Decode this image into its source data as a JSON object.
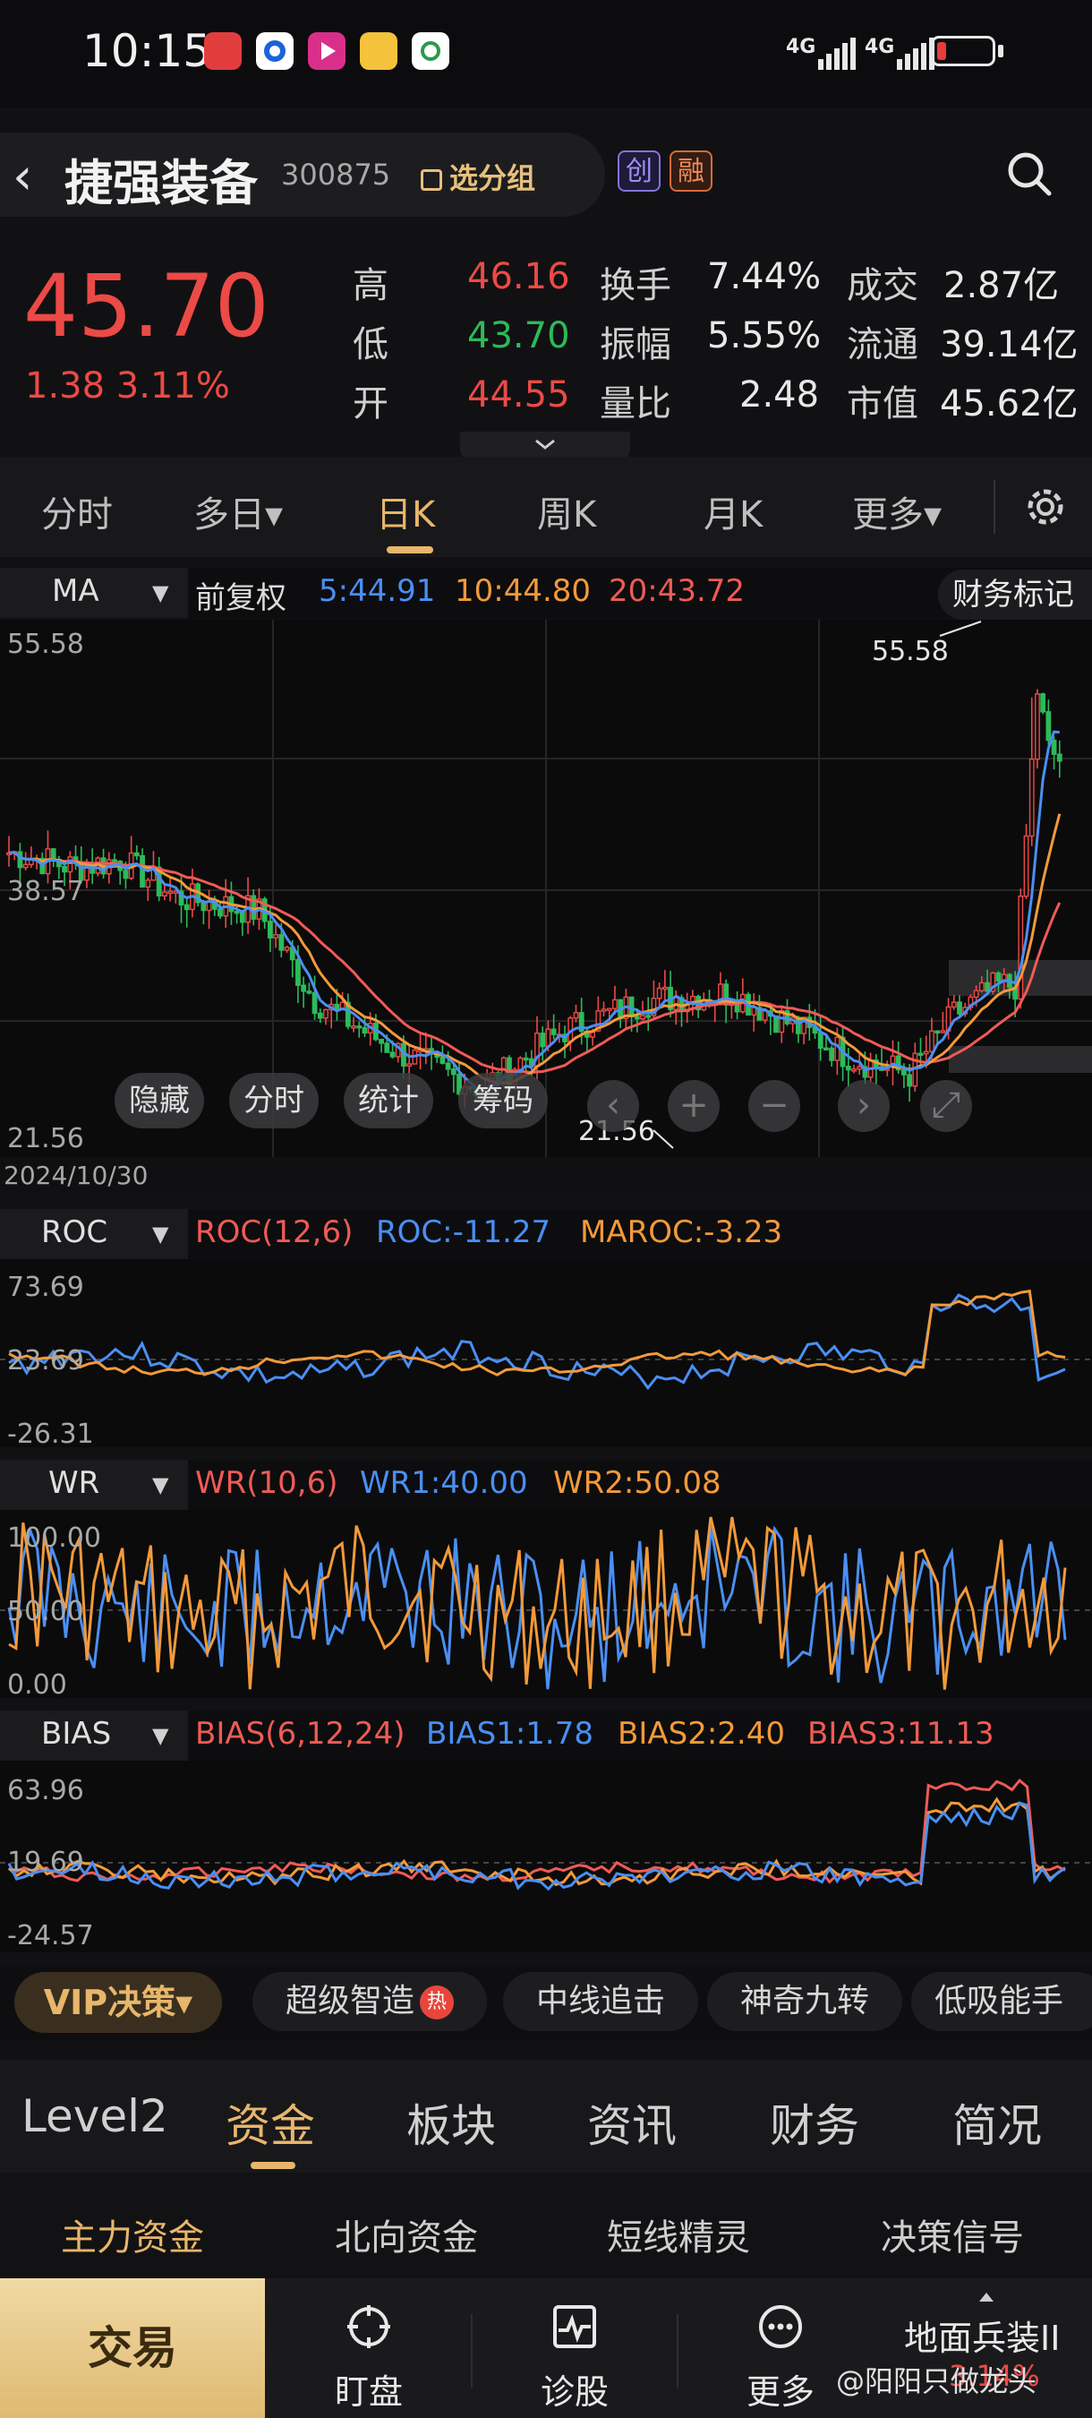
{
  "status": {
    "time": "10:15",
    "signal1": "4G",
    "signal2": "4G"
  },
  "header": {
    "back": "‹",
    "name": "捷强装备",
    "code": "300875",
    "select_group": "选分组",
    "badge_chuang": "创",
    "badge_rong": "融"
  },
  "quote": {
    "price": "45.70",
    "change": "1.38 3.11%",
    "rows": [
      {
        "l1": "高",
        "v1": "46.16",
        "l2": "换手",
        "v2": "7.44%",
        "l3": "成交",
        "v3": "2.87亿"
      },
      {
        "l1": "低",
        "v1": "43.70",
        "l2": "振幅",
        "v2": "5.55%",
        "l3": "流通",
        "v3": "39.14亿"
      },
      {
        "l1": "开",
        "v1": "44.55",
        "l2": "量比",
        "v2": "2.48",
        "l3": "市值",
        "v3": "45.62亿"
      }
    ]
  },
  "period_tabs": [
    "分时",
    "多日▾",
    "日K",
    "周K",
    "月K",
    "更多▾"
  ],
  "ma": {
    "name": "MA",
    "adjust": "前复权",
    "ma5": "5:44.91",
    "ma10": "10:44.80",
    "ma20": "20:43.72",
    "fin_mark": "财务标记",
    "y_top": "55.58",
    "y_mid": "38.57",
    "y_bot": "21.56",
    "hi_label": "55.58",
    "lo_label": "21.56",
    "date": "2024/10/30",
    "chips": [
      "隐藏",
      "分时",
      "统计",
      "筹码"
    ]
  },
  "roc": {
    "name": "ROC",
    "params": "ROC(12,6)",
    "v1": "ROC:-11.27",
    "v2": "MAROC:-3.23",
    "y_top": "73.69",
    "y_mid": "23.69",
    "y_bot": "-26.31"
  },
  "wr": {
    "name": "WR",
    "params": "WR(10,6)",
    "v1": "WR1:40.00",
    "v2": "WR2:50.08",
    "y_top": "100.00",
    "y_mid": "50.00",
    "y_bot": "0.00"
  },
  "bias": {
    "name": "BIAS",
    "params": "BIAS(6,12,24)",
    "v1": "BIAS1:1.78",
    "v2": "BIAS2:2.40",
    "v3": "BIAS3:11.13",
    "y_top": "63.96",
    "y_mid": "19.69",
    "y_bot": "-24.57"
  },
  "vip": {
    "label": "VIP决策▾",
    "tags": [
      "超级智造",
      "中线追击",
      "神奇九转",
      "低吸能手"
    ],
    "hot": "热"
  },
  "section_tabs": [
    "Level2",
    "资金",
    "板块",
    "资讯",
    "财务",
    "简况"
  ],
  "sub_tabs": [
    "主力资金",
    "北向资金",
    "短线精灵",
    "决策信号"
  ],
  "bottom": {
    "trade": "交易",
    "nav": [
      "盯盘",
      "诊股",
      "更多"
    ],
    "related_name": "地面兵装II",
    "related_pct": "3.14%",
    "watermark": "@阳阳只做龙头"
  },
  "colors": {
    "up": "#ec4a46",
    "down": "#2cbb59",
    "accent": "#e8b66b",
    "ma5": "#4a8ff2",
    "ma10": "#f29a3a",
    "ma20": "#ef5b55"
  }
}
